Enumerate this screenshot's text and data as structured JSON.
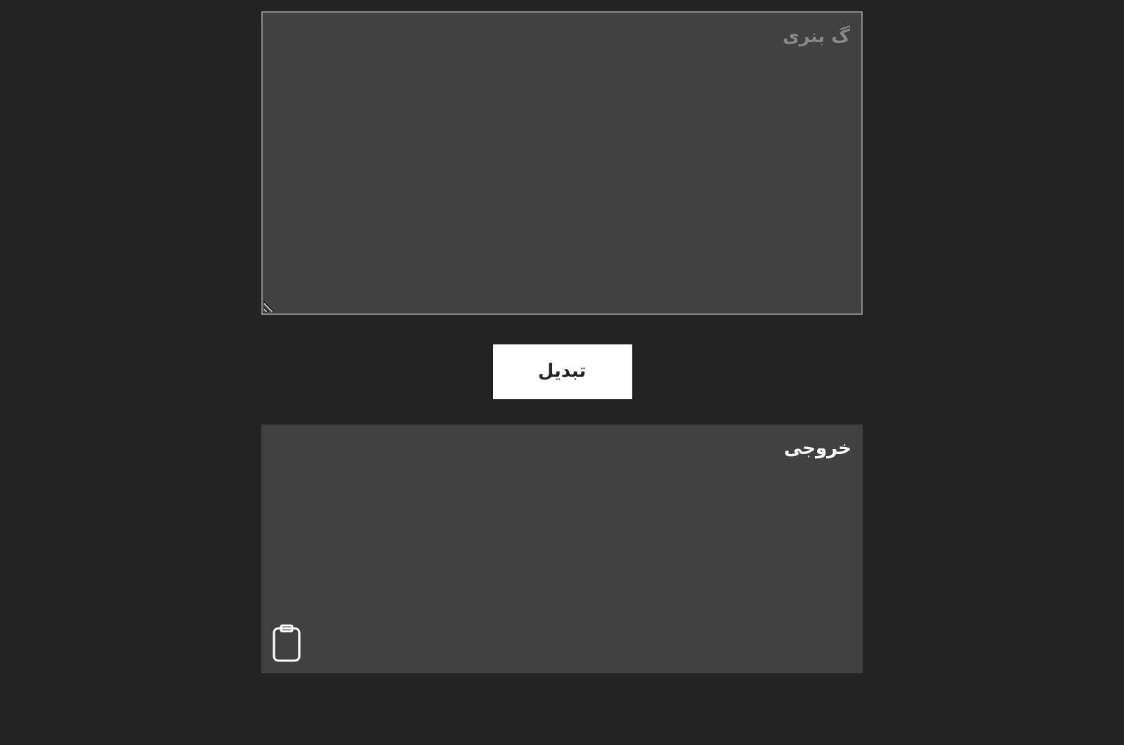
{
  "input": {
    "placeholder": "گ بنری"
  },
  "convert_button": {
    "label": "تبدیل"
  },
  "output": {
    "text": "خروجی"
  }
}
